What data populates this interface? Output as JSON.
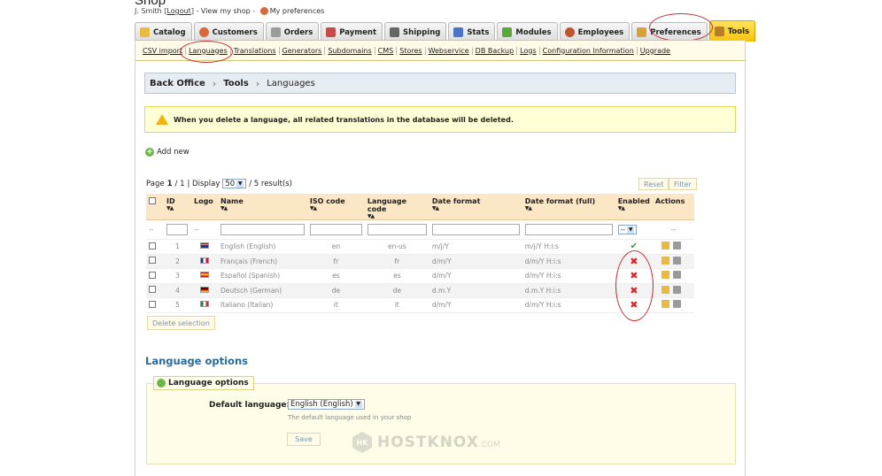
{
  "header": {
    "shop_title": "Shop",
    "user_name": "J. Smith",
    "logout": "Logout",
    "view_shop": "View my shop",
    "preferences": "My preferences"
  },
  "tabs": [
    {
      "label": "Catalog",
      "icon": "folder-icon",
      "color": "#e9b940"
    },
    {
      "label": "Customers",
      "icon": "person-icon",
      "color": "#d86a3a"
    },
    {
      "label": "Orders",
      "icon": "cart-icon",
      "color": "#9b9b9b"
    },
    {
      "label": "Payment",
      "icon": "payment-icon",
      "color": "#c74a4a"
    },
    {
      "label": "Shipping",
      "icon": "truck-icon",
      "color": "#666666"
    },
    {
      "label": "Stats",
      "icon": "chart-icon",
      "color": "#4a74c7"
    },
    {
      "label": "Modules",
      "icon": "puzzle-icon",
      "color": "#58a83a"
    },
    {
      "label": "Employees",
      "icon": "employee-icon",
      "color": "#c0532f"
    },
    {
      "label": "Preferences",
      "icon": "preferences-icon",
      "color": "#d9a13a"
    },
    {
      "label": "Tools",
      "icon": "tools-icon",
      "color": "#b77d2a"
    }
  ],
  "subnav": [
    "CSV import",
    "Languages",
    "Translations",
    "Generators",
    "Subdomains",
    "CMS",
    "Stores",
    "Webservice",
    "DB Backup",
    "Logs",
    "Configuration Information",
    "Upgrade"
  ],
  "breadcrumb": {
    "root": "Back Office",
    "section": "Tools",
    "page": "Languages"
  },
  "warning": "When you delete a language, all related translations in the database will be deleted.",
  "add_new": "Add new",
  "pager": {
    "page_label": "Page",
    "current": "1",
    "total": "/ 1",
    "display_label": "| Display",
    "per_page": "50",
    "results": "/ 5 result(s)"
  },
  "buttons": {
    "reset": "Reset",
    "filter": "Filter",
    "delete_selection": "Delete selection",
    "save": "Save"
  },
  "table": {
    "headers": {
      "id": "ID",
      "logo": "Logo",
      "name": "Name",
      "iso": "ISO code",
      "lang_code": "Language code",
      "date_format": "Date format",
      "date_format_full": "Date format (full)",
      "enabled": "Enabled",
      "actions": "Actions"
    },
    "filter_placeholders": {
      "check": "--",
      "logo": "--",
      "enabled": "--",
      "actions": "--"
    },
    "rows": [
      {
        "id": "1",
        "flag": "english-flag-icon",
        "name": "English (English)",
        "iso": "en",
        "code": "en-us",
        "date": "m/j/Y",
        "date_full": "m/j/Y H:i:s",
        "enabled": true
      },
      {
        "id": "2",
        "flag": "french-flag-icon",
        "name": "Français (French)",
        "iso": "fr",
        "code": "fr",
        "date": "d/m/Y",
        "date_full": "d/m/Y H:i:s",
        "enabled": false
      },
      {
        "id": "3",
        "flag": "spanish-flag-icon",
        "name": "Español (Spanish)",
        "iso": "es",
        "code": "es",
        "date": "d/m/Y",
        "date_full": "d/m/Y H:i:s",
        "enabled": false
      },
      {
        "id": "4",
        "flag": "german-flag-icon",
        "name": "Deutsch (German)",
        "iso": "de",
        "code": "de",
        "date": "d.m.Y",
        "date_full": "d.m.Y H:i:s",
        "enabled": false
      },
      {
        "id": "5",
        "flag": "italian-flag-icon",
        "name": "Italiano (Italian)",
        "iso": "it",
        "code": "it",
        "date": "d/m/Y",
        "date_full": "d/m/Y H:i:s",
        "enabled": false
      }
    ]
  },
  "options": {
    "section_title": "Language options",
    "legend": "Language options",
    "default_label": "Default language:",
    "default_value": "English (English)",
    "hint": "The default language used in your shop"
  },
  "watermark": {
    "brand": "HOSTKNOX",
    "suffix": ".COM",
    "badge": "HK"
  },
  "colors": {
    "tools_tab": "#f5c30f",
    "highlight_circle": "#c0303a",
    "section_title": "#2a6b9a"
  }
}
